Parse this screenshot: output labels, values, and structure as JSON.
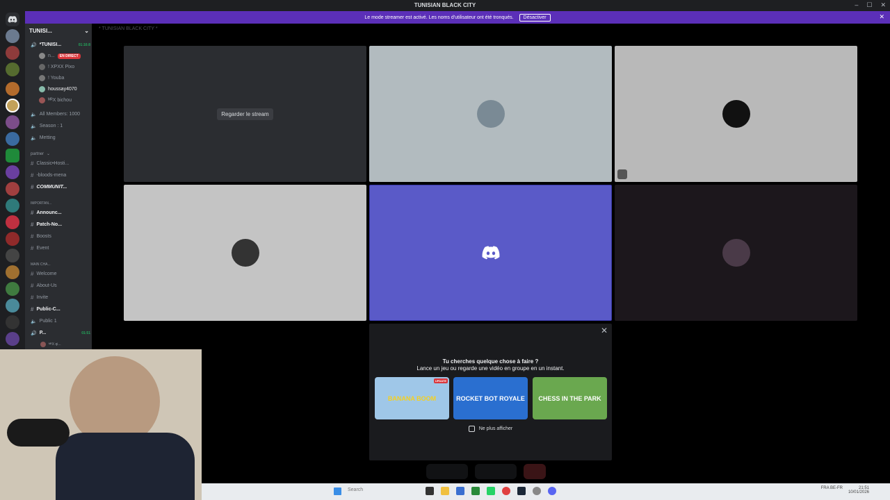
{
  "window": {
    "title": "TUNISIAN BLACK CITY"
  },
  "banner": {
    "text": "Le mode streamer est activé. Les noms d'utilisateur ont été tronqués.",
    "button": "Désactiver"
  },
  "server": {
    "name": "TUNISI..."
  },
  "channels": {
    "voice_top": {
      "name": "*TUNISI...",
      "counter": "01:16:8"
    },
    "live_badge": "EN DIRECT",
    "members": [
      {
        "name": "n..."
      },
      {
        "name": "! XPXX Pixo"
      },
      {
        "name": "! Youba"
      },
      {
        "name": "houssay4070"
      },
      {
        "name": "ᴹᴿX bichou"
      }
    ],
    "all_members": "All Members: 1000",
    "season": "Season : 1",
    "metting": "Metting",
    "partner_cat": "partner",
    "items": [
      "Classic•Hosti...",
      "-bloods-mena",
      "COMMUNIT...",
      "IMPORTAN...",
      "Announc...",
      "Patch-No...",
      "Boosts",
      "Event",
      "MAIN CHA...",
      "Welcome",
      "About-Us",
      "Invite",
      "Public-C...",
      "Public 1",
      "P...",
      "ᴹᴿX qi..."
    ],
    "public_p_counter": "01:51"
  },
  "main": {
    "breadcrumb": "* TUNISIAN BLACK CITY *",
    "watch_stream": "Regarder le stream",
    "tile_colors": [
      "#2b2d31",
      "#b2bbbf",
      "#b9b9b9",
      "#c4c4c4",
      "#5a5ac8",
      "#1c171c"
    ]
  },
  "popup": {
    "line1": "Tu cherches quelque chose à faire ?",
    "line2": "Lance un jeu ou regarde une vidéo en groupe en un instant.",
    "games": [
      {
        "name": "BANANA BOOM",
        "badge": "UPDATE"
      },
      {
        "name": "ROCKET BOT ROYALE"
      },
      {
        "name": "CHESS IN THE PARK"
      }
    ],
    "dont_show": "Ne plus afficher"
  },
  "taskbar": {
    "search": "Search",
    "lang": "FRA BE-FR",
    "time": "21:51",
    "date": "10/01/2026"
  }
}
